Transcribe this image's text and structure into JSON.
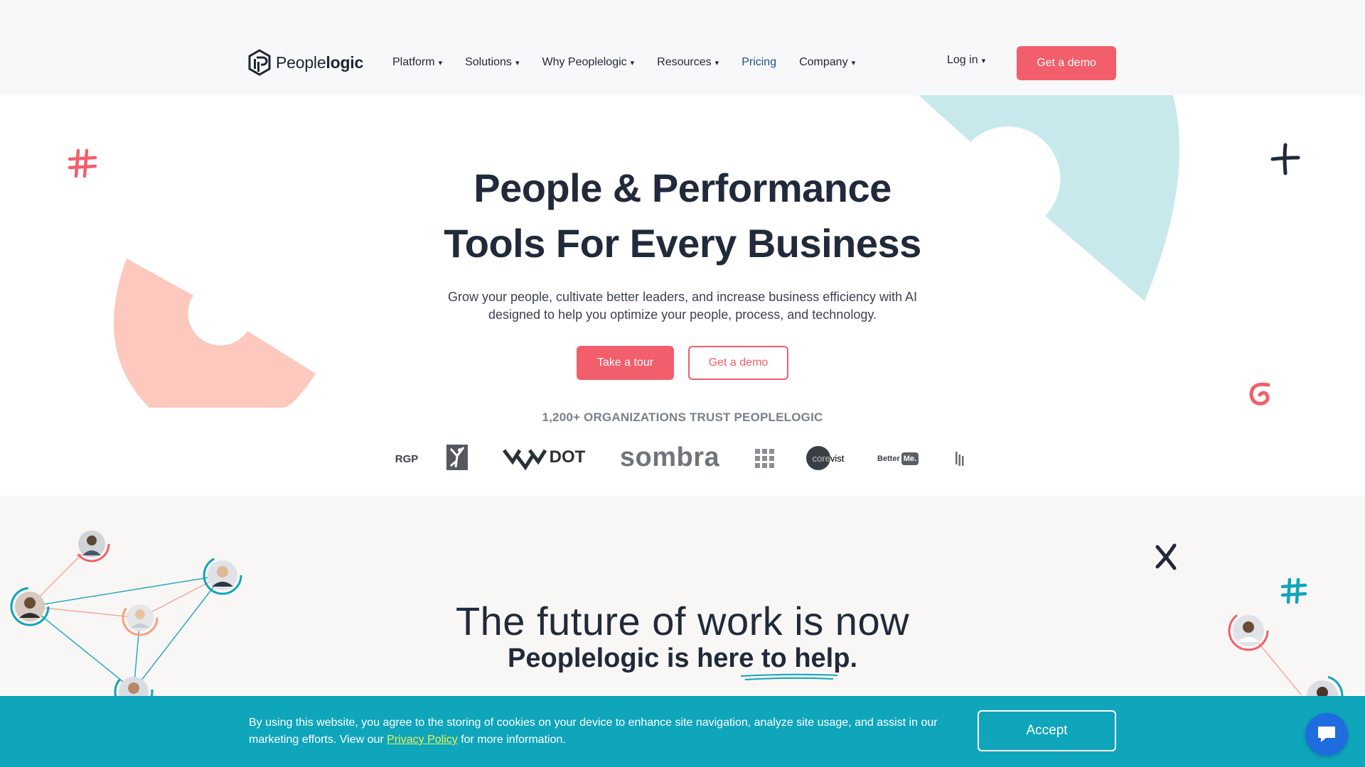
{
  "header": {
    "logo_text_regular": "People",
    "logo_text_bold": "logic",
    "nav": [
      {
        "label": "Platform",
        "has_dropdown": true
      },
      {
        "label": "Solutions",
        "has_dropdown": true
      },
      {
        "label": "Why Peoplelogic",
        "has_dropdown": true
      },
      {
        "label": "Resources",
        "has_dropdown": true
      },
      {
        "label": "Pricing",
        "has_dropdown": false
      },
      {
        "label": "Company",
        "has_dropdown": true
      }
    ],
    "login_label": "Log in",
    "demo_label": "Get a demo",
    "caret": "▾"
  },
  "hero": {
    "title_line1": "People & Performance",
    "title_line2": "Tools For Every Business",
    "subtitle_line1": "Grow your people, cultivate better leaders, and increase business efficiency with AI",
    "subtitle_line2": "designed to help you optimize your people, process, and technology.",
    "tour_label": "Take a tour",
    "demo_label": "Get a demo",
    "trust_text": "1,200+ ORGANIZATIONS TRUST PEOPLELOGIC",
    "customer_logos": {
      "rgp": "RGP",
      "redot": "DOT",
      "sombra": "sombra",
      "corevist": "corevist",
      "betterme_a": "Better",
      "betterme_b": "Me."
    }
  },
  "future": {
    "title": "The future of work is now",
    "subtitle": "Peoplelogic is here to help."
  },
  "cookie": {
    "text_before": "By using this website, you agree to the storing of cookies on your device to enhance site navigation, analyze site usage, and assist in our marketing efforts. View our ",
    "link": "Privacy Policy",
    "text_after": " for more information.",
    "accept_label": "Accept"
  },
  "colors": {
    "brand_coral": "#f25e6b",
    "teal": "#0fa5bb",
    "navy": "#212a3a",
    "light_blue_shape": "#c8e9ec",
    "peach_shape": "#fdc8bd"
  },
  "icons": {
    "chat": "chat-bubble-icon"
  }
}
